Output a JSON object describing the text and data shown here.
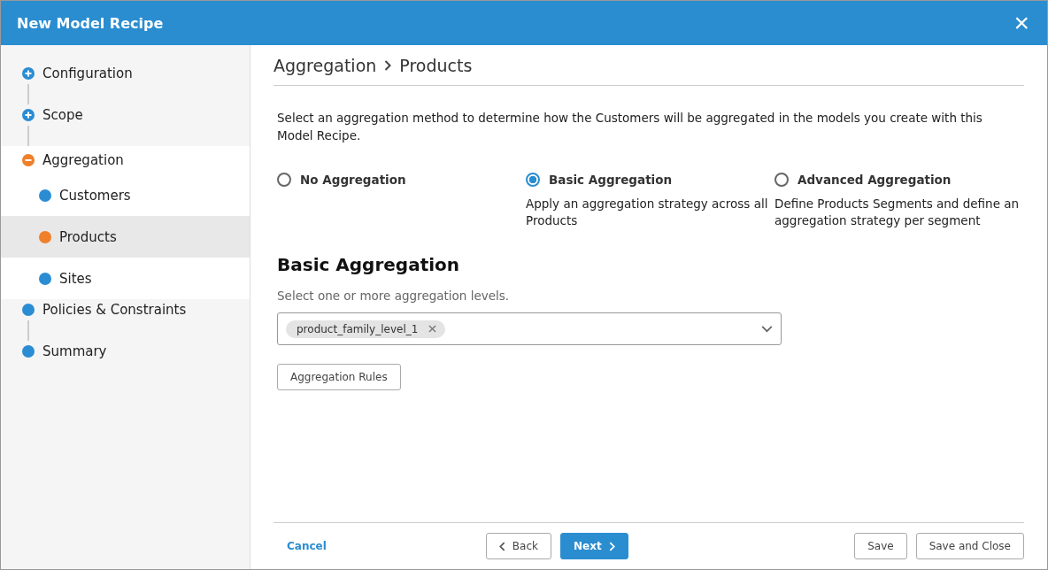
{
  "window": {
    "title": "New Model Recipe",
    "close_glyph": "×"
  },
  "steps": [
    {
      "label": "Configuration",
      "kind": "collapsed",
      "color": "#2a8dd4",
      "selected": false
    },
    {
      "label": "Scope",
      "kind": "collapsed",
      "color": "#2a8dd4",
      "selected": false
    },
    {
      "label": "Aggregation",
      "kind": "expanded",
      "color": "#f07f2a",
      "selected": false,
      "children": [
        {
          "label": "Customers",
          "kind": "step",
          "color": "#2a8dd4",
          "selected": false
        },
        {
          "label": "Products",
          "kind": "step",
          "color": "#f07f2a",
          "selected": true
        },
        {
          "label": "Sites",
          "kind": "step",
          "color": "#2a8dd4",
          "selected": false
        }
      ]
    },
    {
      "label": "Policies & Constraints",
      "kind": "step",
      "color": "#2a8dd4",
      "selected": false
    },
    {
      "label": "Summary",
      "kind": "step",
      "color": "#2a8dd4",
      "selected": false
    }
  ],
  "breadcrumb": [
    "Aggregation",
    "Products"
  ],
  "intro": "Select an aggregation method to determine how the Customers will be aggregated in the models you create with this Model Recipe.",
  "methods": [
    {
      "label": "No Aggregation",
      "selected": false
    },
    {
      "label": "Basic Aggregation",
      "selected": true,
      "description": "Apply an aggregation strategy across all Products"
    },
    {
      "label": "Advanced Aggregation",
      "selected": false,
      "description": "Define Products Segments and define an aggregation strategy per segment"
    }
  ],
  "section": {
    "title": "Basic Aggregation",
    "hint": "Select one or more aggregation levels.",
    "tags": [
      "product_family_level_1"
    ],
    "rules_button": "Aggregation Rules"
  },
  "footer": {
    "cancel": "Cancel",
    "back": "Back",
    "next": "Next",
    "save": "Save",
    "save_close": "Save and Close"
  }
}
